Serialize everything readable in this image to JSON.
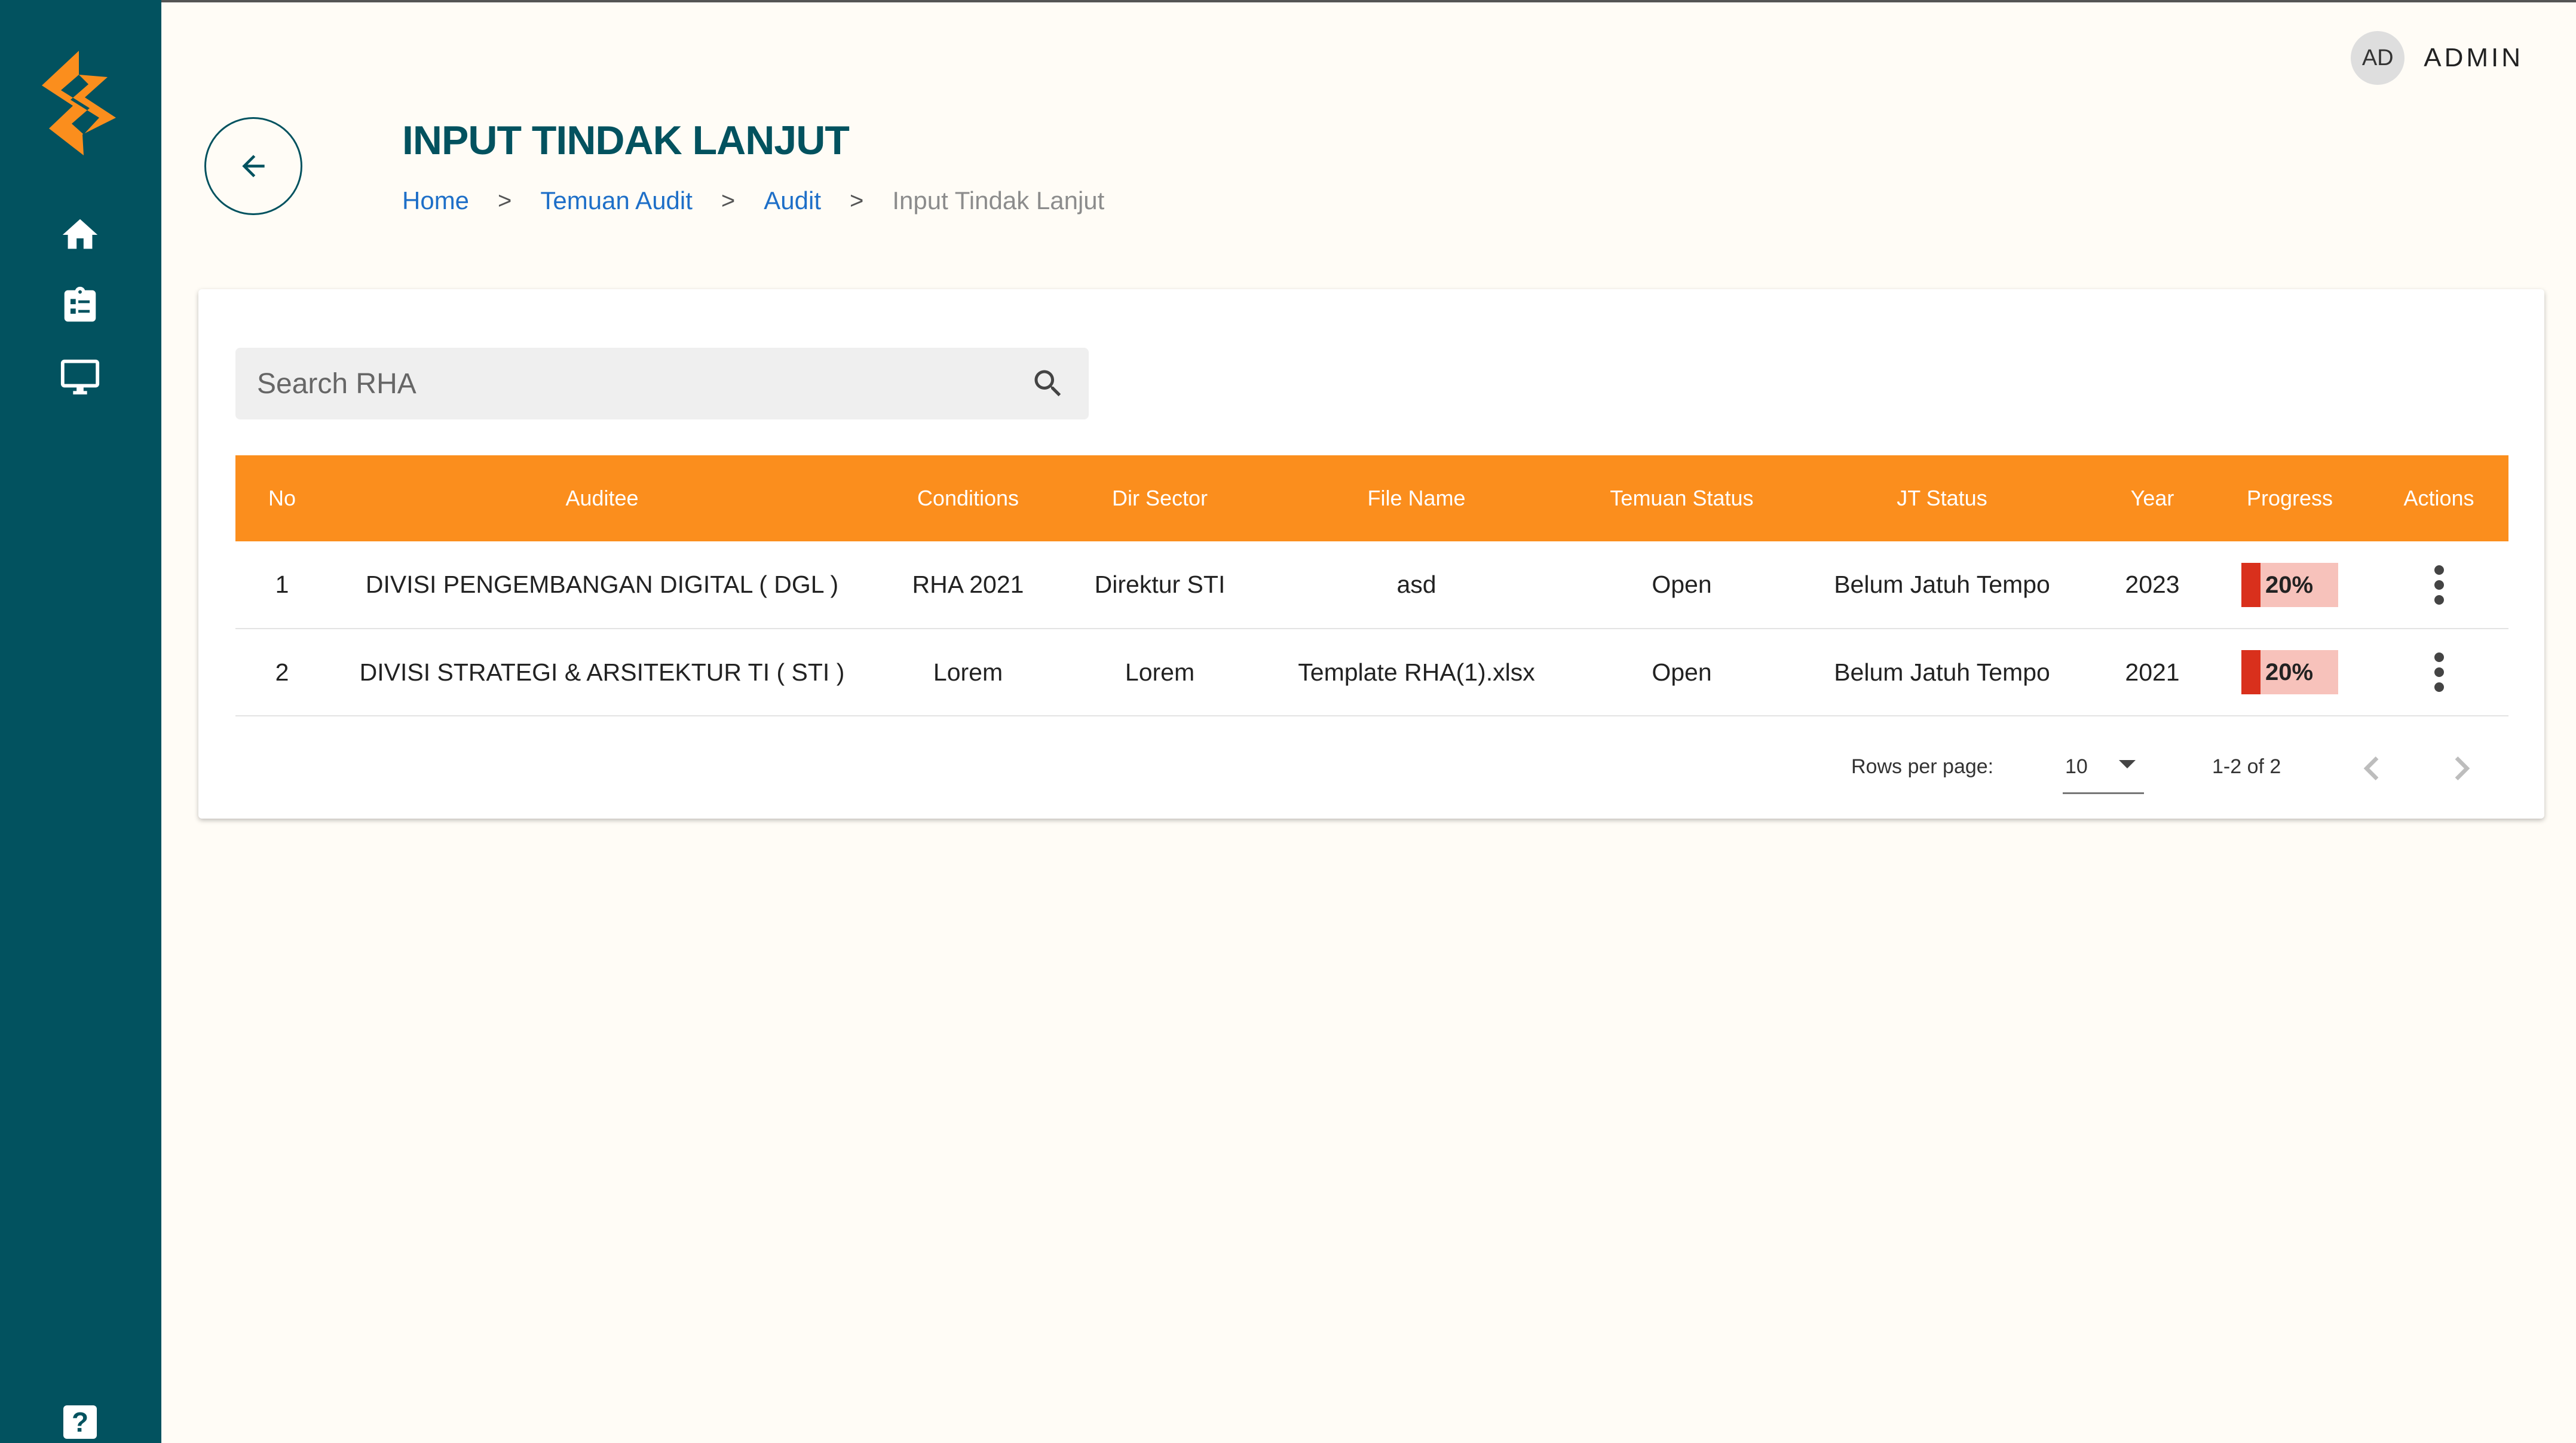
{
  "header": {
    "user_initials": "AD",
    "user_name": "ADMIN",
    "page_title": "INPUT TINDAK LANJUT"
  },
  "breadcrumb": {
    "items": [
      "Home",
      "Temuan Audit",
      "Audit"
    ],
    "current": "Input Tindak Lanjut",
    "separator": ">"
  },
  "sidebar": {
    "icons": [
      "brand-logo",
      "home-icon",
      "clipboard-list-icon",
      "monitor-icon",
      "help-icon"
    ],
    "help_label": "?"
  },
  "search": {
    "placeholder": "Search RHA",
    "value": ""
  },
  "table": {
    "columns": [
      "No",
      "Auditee",
      "Conditions",
      "Dir Sector",
      "File Name",
      "Temuan Status",
      "JT Status",
      "Year",
      "Progress",
      "Actions"
    ],
    "rows": [
      {
        "no": "1",
        "auditee": "DIVISI PENGEMBANGAN DIGITAL ( DGL )",
        "conditions": "RHA 2021",
        "dir_sector": "Direktur STI",
        "file_name": "asd",
        "temuan_status": "Open",
        "jt_status": "Belum Jatuh Tempo",
        "year": "2023",
        "progress": "20%"
      },
      {
        "no": "2",
        "auditee": "DIVISI STRATEGI & ARSITEKTUR TI ( STI )",
        "conditions": "Lorem",
        "dir_sector": "Lorem",
        "file_name": "Template RHA(1).xlsx",
        "temuan_status": "Open",
        "jt_status": "Belum Jatuh Tempo",
        "year": "2021",
        "progress": "20%"
      }
    ]
  },
  "pagination": {
    "rows_per_page_label": "Rows per page:",
    "rows_per_page": "10",
    "range": "1-2 of 2"
  },
  "colors": {
    "sidebar": "#02525f",
    "accent": "#fb8e1d",
    "title": "#02525f",
    "link": "#1e6fc8",
    "progress_fill": "#d9301c",
    "progress_track": "#f7c2bb",
    "background": "#fffcf6"
  }
}
